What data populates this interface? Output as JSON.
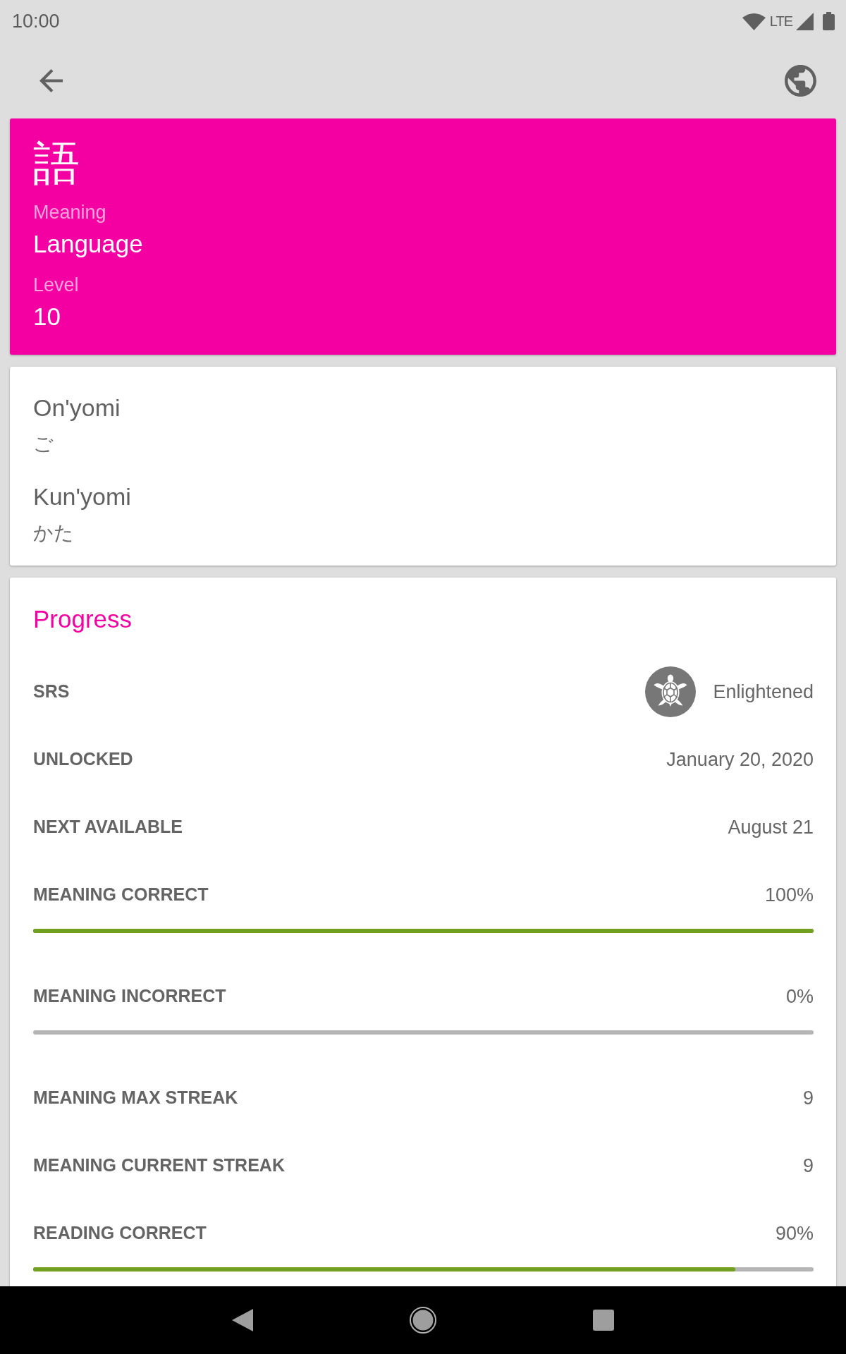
{
  "status_bar": {
    "time": "10:00",
    "network": "LTE"
  },
  "kanji_card": {
    "character": "語",
    "fields": [
      {
        "label": "Meaning",
        "value": "Language"
      },
      {
        "label": "Level",
        "value": "10"
      }
    ]
  },
  "readings_card": {
    "readings": [
      {
        "label": "On'yomi",
        "value": "ご"
      },
      {
        "label": "Kun'yomi",
        "value": "かた"
      }
    ]
  },
  "progress": {
    "title": "Progress",
    "rows": [
      {
        "kind": "srs",
        "label": "SRS",
        "value": "Enlightened"
      },
      {
        "kind": "text",
        "label": "UNLOCKED",
        "value": "January 20, 2020"
      },
      {
        "kind": "text",
        "label": "NEXT AVAILABLE",
        "value": "August 21"
      },
      {
        "kind": "bar",
        "label": "MEANING CORRECT",
        "value": "100%",
        "level": 1
      },
      {
        "kind": "bar",
        "label": "MEANING INCORRECT",
        "value": "0%",
        "level": 0
      },
      {
        "kind": "text",
        "label": "MEANING MAX STREAK",
        "value": "9"
      },
      {
        "kind": "text",
        "label": "MEANING CURRENT STREAK",
        "value": "9"
      },
      {
        "kind": "bar",
        "label": "READING CORRECT",
        "value": "90%",
        "level": 0.9
      }
    ]
  }
}
